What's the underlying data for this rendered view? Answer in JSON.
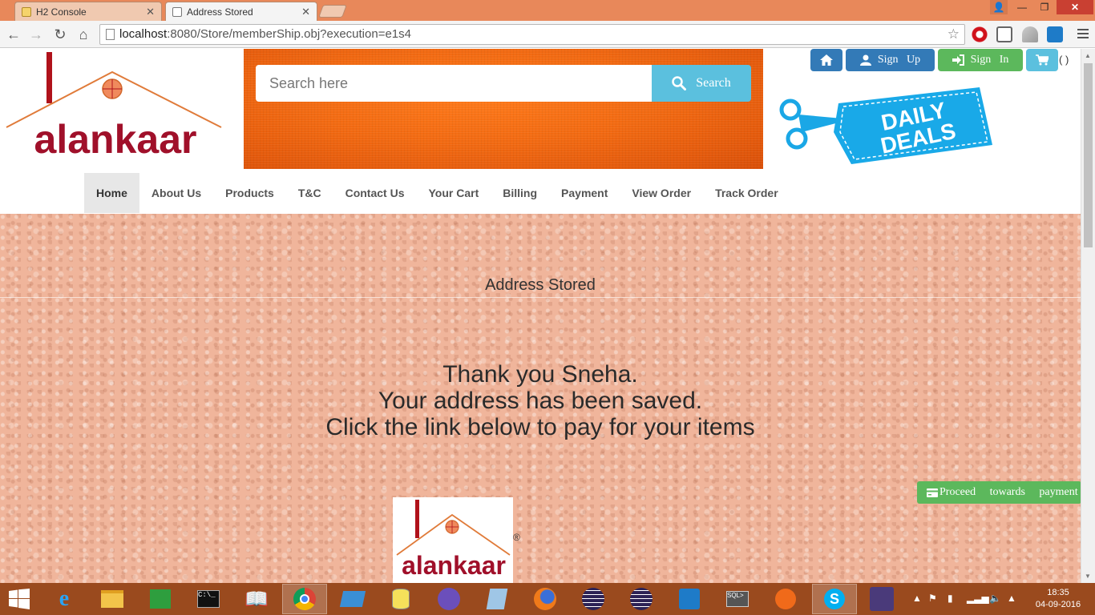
{
  "browser": {
    "tabs": [
      {
        "title": "H2 Console"
      },
      {
        "title": "Address Stored"
      }
    ],
    "url": {
      "host": "localhost",
      "rest": ":8080/Store/memberShip.obj?execution=e1s4"
    }
  },
  "header": {
    "brand": "alankaar",
    "search_placeholder": "Search here",
    "search_label": "Search",
    "signup_label": "Sign   Up",
    "signin_label": "Sign   In",
    "cart_count": "( )",
    "deals_line1": "DAILY",
    "deals_line2": "DEALS"
  },
  "nav": {
    "items": [
      "Home",
      "About Us",
      "Products",
      "T&C",
      "Contact Us",
      "Your Cart",
      "Billing",
      "Payment",
      "View Order",
      "Track Order"
    ],
    "active": "Home"
  },
  "main": {
    "title": "Address Stored",
    "message_lines": [
      "Thank you Sneha.",
      "Your address has been saved.",
      "Click the link below to pay for your items"
    ],
    "proceed_label": "Proceed towards payment",
    "footer_brand": "alankaar",
    "registered": "®"
  },
  "taskbar": {
    "time": "18:35",
    "date": "04-09-2016"
  },
  "colors": {
    "primary": "#337ab7",
    "success": "#5cb85c",
    "info": "#5bc0de",
    "brand": "#a0102a",
    "titlebar": "#e8885a",
    "taskbar": "#9a4a1e"
  }
}
